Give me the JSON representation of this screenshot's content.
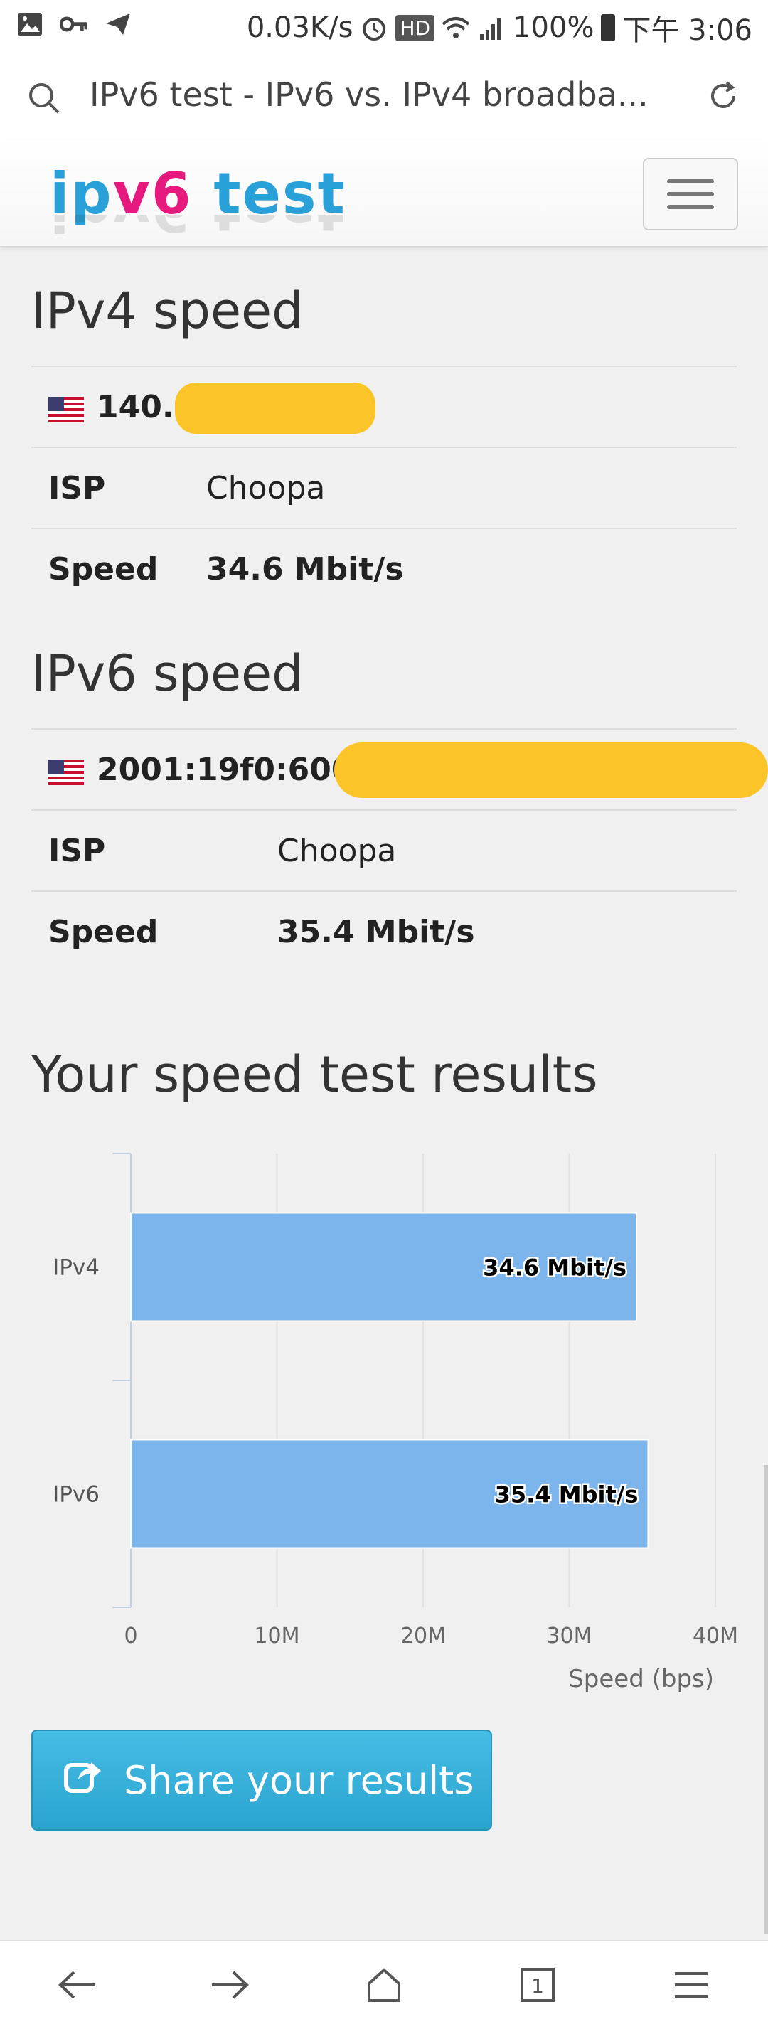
{
  "status_bar": {
    "net_speed": "0.03K/s",
    "hd": "HD",
    "signal": "4G",
    "battery": "100%",
    "time": "下午 3:06"
  },
  "address_bar": {
    "title": "IPv6 test - IPv6 vs. IPv4 broadba..."
  },
  "site": {
    "logo_part1": "ipv6",
    "logo_part2": " test"
  },
  "ipv4": {
    "heading": "IPv4 speed",
    "address": "140.",
    "isp_label": "ISP",
    "isp_value": "Choopa",
    "speed_label": "Speed",
    "speed_value": "34.6 Mbit/s"
  },
  "ipv6": {
    "heading": "IPv6 speed",
    "address": "2001:19f0:6001:",
    "isp_label": "ISP",
    "isp_value": "Choopa",
    "speed_label": "Speed",
    "speed_value": "35.4 Mbit/s"
  },
  "results": {
    "heading": "Your speed test results",
    "share_label": "Share your results"
  },
  "chart_data": {
    "type": "bar",
    "orientation": "horizontal",
    "categories": [
      "IPv4",
      "IPv6"
    ],
    "values": [
      34.6,
      35.4
    ],
    "value_labels": [
      "34.6 Mbit/s",
      "35.4 Mbit/s"
    ],
    "xlabel": "Speed (bps)",
    "xlim": [
      0,
      40
    ],
    "x_ticks": [
      0,
      10,
      20,
      30,
      40
    ],
    "x_tick_labels": [
      "0",
      "10M",
      "20M",
      "30M",
      "40M"
    ],
    "grid": true,
    "bar_color": "#7cb5ec"
  },
  "colors": {
    "accent": "#29a0d8",
    "logo_pink": "#e5197e",
    "redaction": "#fbc52a",
    "share_button": "#2aa3cf"
  },
  "icons": {
    "nav": [
      "back-icon",
      "forward-icon",
      "home-icon",
      "tabs-icon",
      "menu-icon"
    ],
    "tabs_count": "1"
  }
}
